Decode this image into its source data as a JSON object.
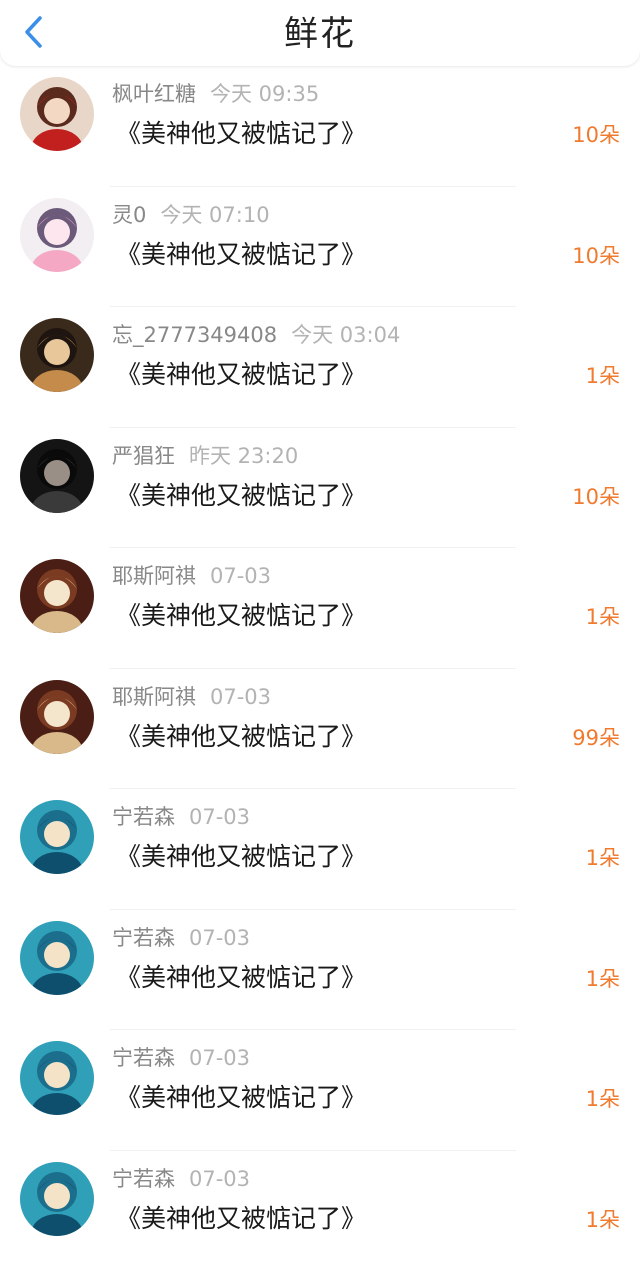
{
  "header": {
    "title": "鲜花"
  },
  "colors": {
    "accent": "#3b8fe8",
    "flower_count": "#f07a2e",
    "username": "#888888",
    "time": "#b3b3b3"
  },
  "items": [
    {
      "user": "枫叶红糖",
      "time": "今天 09:35",
      "book": "《美神他又被惦记了》",
      "count": "10朵",
      "avatar": "red"
    },
    {
      "user": "灵0",
      "time": "今天 07:10",
      "book": "《美神他又被惦记了》",
      "count": "10朵",
      "avatar": "pink"
    },
    {
      "user": "忘_2777349408",
      "time": "今天 03:04",
      "book": "《美神他又被惦记了》",
      "count": "1朵",
      "avatar": "brown"
    },
    {
      "user": "严猖狂",
      "time": "昨天 23:20",
      "book": "《美神他又被惦记了》",
      "count": "10朵",
      "avatar": "dark"
    },
    {
      "user": "耶斯阿祺",
      "time": "07-03",
      "book": "《美神他又被惦记了》",
      "count": "1朵",
      "avatar": "gold"
    },
    {
      "user": "耶斯阿祺",
      "time": "07-03",
      "book": "《美神他又被惦记了》",
      "count": "99朵",
      "avatar": "gold"
    },
    {
      "user": "宁若森",
      "time": "07-03",
      "book": "《美神他又被惦记了》",
      "count": "1朵",
      "avatar": "teal"
    },
    {
      "user": "宁若森",
      "time": "07-03",
      "book": "《美神他又被惦记了》",
      "count": "1朵",
      "avatar": "teal"
    },
    {
      "user": "宁若森",
      "time": "07-03",
      "book": "《美神他又被惦记了》",
      "count": "1朵",
      "avatar": "teal"
    },
    {
      "user": "宁若森",
      "time": "07-03",
      "book": "《美神他又被惦记了》",
      "count": "1朵",
      "avatar": "teal"
    }
  ]
}
